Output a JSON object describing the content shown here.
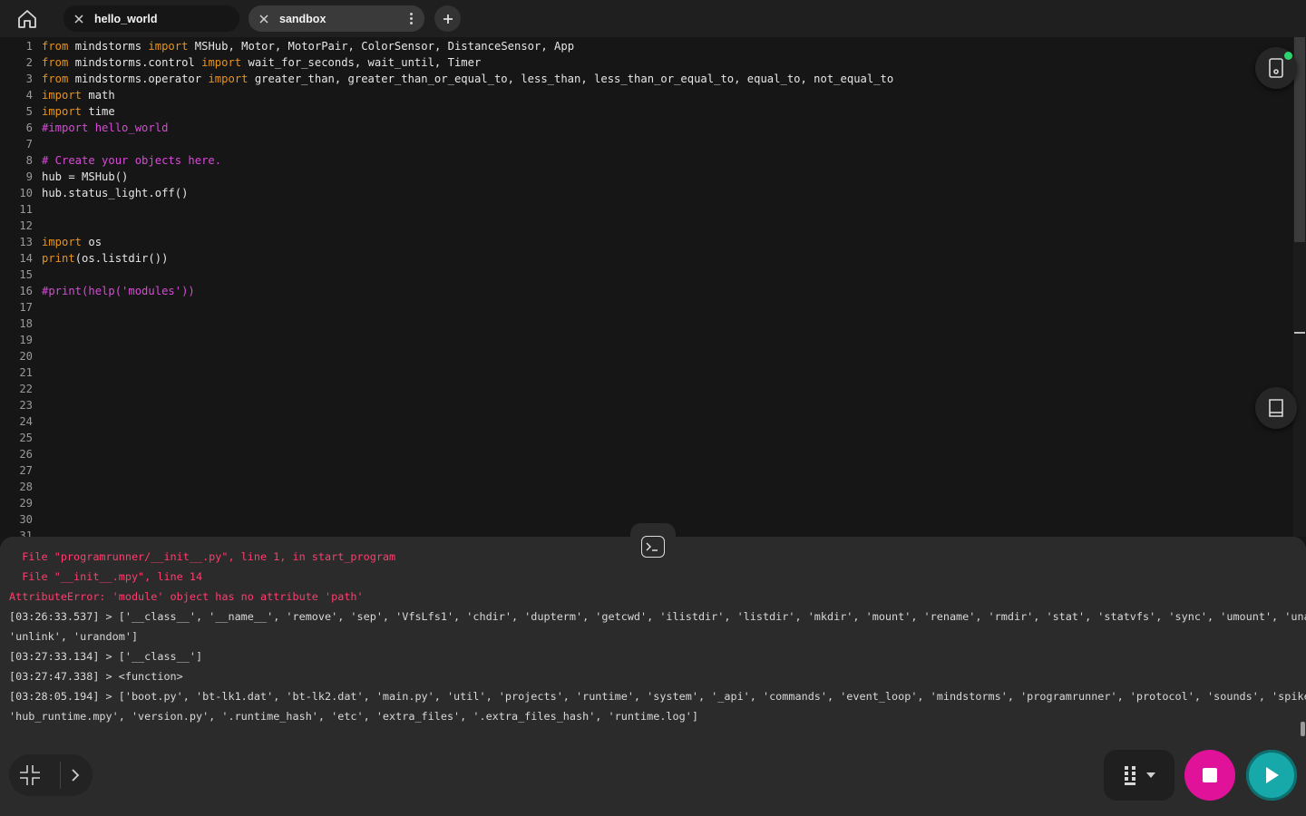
{
  "tabs": [
    {
      "label": "hello_world",
      "active": false
    },
    {
      "label": "sandbox",
      "active": true
    }
  ],
  "icons": {
    "home": "home-icon",
    "tab_close": "close-icon",
    "tab_menu": "kebab-menu-icon",
    "new_tab": "plus-icon",
    "hub": "hub-device-icon",
    "knowledge_base": "book-icon",
    "console_toggle": "terminal-icon",
    "collapse": "collapse-arrows-icon",
    "expand": "chevron-right-icon",
    "slot": "slot-selector-icon",
    "stop": "stop-icon",
    "run": "play-icon"
  },
  "colors": {
    "keyword": "#e9931a",
    "comment": "#d64bd6",
    "error": "#ff3d6e",
    "stop_button": "#e0129a",
    "run_button": "#17a9a9",
    "hub_connected": "#2bd46e"
  },
  "editor": {
    "lines": [
      {
        "n": "1",
        "parts": [
          {
            "t": "from",
            "c": "kw"
          },
          {
            "t": " mindstorms "
          },
          {
            "t": "import",
            "c": "kw"
          },
          {
            "t": " MSHub, Motor, MotorPair, ColorSensor, DistanceSensor, App"
          }
        ]
      },
      {
        "n": "2",
        "parts": [
          {
            "t": "from",
            "c": "kw"
          },
          {
            "t": " mindstorms.control "
          },
          {
            "t": "import",
            "c": "kw"
          },
          {
            "t": " wait_for_seconds, wait_until, Timer"
          }
        ]
      },
      {
        "n": "3",
        "parts": [
          {
            "t": "from",
            "c": "kw"
          },
          {
            "t": " mindstorms.operator "
          },
          {
            "t": "import",
            "c": "kw"
          },
          {
            "t": " greater_than, greater_than_or_equal_to, less_than, less_than_or_equal_to, equal_to, not_equal_to"
          }
        ]
      },
      {
        "n": "4",
        "parts": [
          {
            "t": "import",
            "c": "kw"
          },
          {
            "t": " math"
          }
        ]
      },
      {
        "n": "5",
        "parts": [
          {
            "t": "import",
            "c": "kw"
          },
          {
            "t": " time"
          }
        ]
      },
      {
        "n": "6",
        "parts": [
          {
            "t": "#import hello_world",
            "c": "cm"
          }
        ]
      },
      {
        "n": "7",
        "parts": []
      },
      {
        "n": "8",
        "parts": [
          {
            "t": "# Create your objects here.",
            "c": "cm"
          }
        ]
      },
      {
        "n": "9",
        "parts": [
          {
            "t": "hub = MSHub()"
          }
        ]
      },
      {
        "n": "10",
        "parts": [
          {
            "t": "hub.status_light.off()"
          }
        ]
      },
      {
        "n": "11",
        "parts": []
      },
      {
        "n": "12",
        "parts": []
      },
      {
        "n": "13",
        "parts": [
          {
            "t": "import",
            "c": "kw"
          },
          {
            "t": " os"
          }
        ]
      },
      {
        "n": "14",
        "parts": [
          {
            "t": "print",
            "c": "fn"
          },
          {
            "t": "(os.listdir())"
          }
        ]
      },
      {
        "n": "15",
        "parts": []
      },
      {
        "n": "16",
        "parts": [
          {
            "t": "#print(help('modules'))",
            "c": "cm"
          }
        ]
      },
      {
        "n": "17",
        "parts": []
      },
      {
        "n": "18",
        "parts": []
      },
      {
        "n": "19",
        "parts": []
      },
      {
        "n": "20",
        "parts": []
      },
      {
        "n": "21",
        "parts": []
      },
      {
        "n": "22",
        "parts": []
      },
      {
        "n": "23",
        "parts": []
      },
      {
        "n": "24",
        "parts": []
      },
      {
        "n": "25",
        "parts": []
      },
      {
        "n": "26",
        "parts": []
      },
      {
        "n": "27",
        "parts": []
      },
      {
        "n": "28",
        "parts": []
      },
      {
        "n": "29",
        "parts": []
      },
      {
        "n": "30",
        "parts": []
      },
      {
        "n": "31",
        "parts": []
      }
    ]
  },
  "console": {
    "lines": [
      {
        "text": "  File \"programrunner/__init__.py\", line 1, in start_program",
        "kind": "err"
      },
      {
        "text": "  File \"__init__.mpy\", line 14",
        "kind": "err"
      },
      {
        "text": "AttributeError: 'module' object has no attribute 'path'",
        "kind": "err"
      },
      {
        "text": "[03:26:33.537] > ['__class__', '__name__', 'remove', 'sep', 'VfsLfs1', 'chdir', 'dupterm', 'getcwd', 'ilistdir', 'listdir', 'mkdir', 'mount', 'rename', 'rmdir', 'stat', 'statvfs', 'sync', 'umount', 'uname',",
        "kind": "out"
      },
      {
        "text": "'unlink', 'urandom']",
        "kind": "out"
      },
      {
        "text": "[03:27:33.134] > ['__class__']",
        "kind": "out"
      },
      {
        "text": "[03:27:47.338] > <function>",
        "kind": "out"
      },
      {
        "text": "[03:28:05.194] > ['boot.py', 'bt-lk1.dat', 'bt-lk2.dat', 'main.py', 'util', 'projects', 'runtime', 'system', '_api', 'commands', 'event_loop', 'mindstorms', 'programrunner', 'protocol', 'sounds', 'spike', 'ui',",
        "kind": "out"
      },
      {
        "text": "'hub_runtime.mpy', 'version.py', '.runtime_hash', 'etc', 'extra_files', '.extra_files_hash', 'runtime.log']",
        "kind": "out"
      }
    ]
  }
}
